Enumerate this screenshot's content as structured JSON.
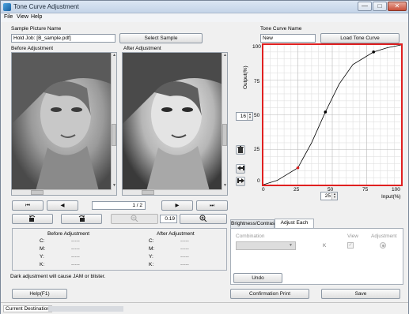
{
  "window": {
    "title": "Tone Curve Adjustment",
    "minimize": "—",
    "maximize": "□",
    "close": "✕"
  },
  "menu": [
    "File",
    "View",
    "Help"
  ],
  "sample": {
    "label": "Sample Picture Name",
    "value": "Hold Job: [B_sample.pdf]",
    "button": "Select Sample"
  },
  "before_label": "Before Adjustment",
  "after_label": "After Adjustment",
  "nav": {
    "first": "⏮",
    "prev": "◀",
    "next": "▶",
    "last": "⏭",
    "page": "1",
    "page_sep": "/",
    "page_total": "2"
  },
  "tools": {
    "rotate_left_icon": "rotate-left-icon",
    "rotate_right_icon": "rotate-right-icon",
    "zoom_out_icon": "zoom-out-icon",
    "zoom_value": "0.19",
    "zoom_in_icon": "zoom-in-icon"
  },
  "color_table": {
    "before_header": "Before Adjustment",
    "after_header": "After Adjustment",
    "rows": [
      {
        "label": "C:",
        "before": "-----",
        "after": "-----"
      },
      {
        "label": "M:",
        "before": "-----",
        "after": "-----"
      },
      {
        "label": "Y:",
        "before": "-----",
        "after": "-----"
      },
      {
        "label": "K:",
        "before": "-----",
        "after": "-----"
      }
    ]
  },
  "warning": "Dark adjustment will cause JAM or blister.",
  "help_button": "Help(F1)",
  "tone_curve": {
    "label": "Tone Curve Name",
    "value": "New",
    "button": "Load Tone Curve"
  },
  "graph": {
    "ylabel": "Output(%)",
    "xlabel": "Input(%)",
    "yticks": [
      "100",
      "75",
      "50",
      "25",
      "0"
    ],
    "xticks": [
      "0",
      "25",
      "50",
      "75",
      "100"
    ]
  },
  "chart_data": {
    "type": "line",
    "x": [
      0,
      10,
      25,
      35,
      45,
      55,
      65,
      80,
      90,
      100
    ],
    "y": [
      0,
      3,
      12,
      30,
      52,
      72,
      86,
      95,
      98,
      100
    ],
    "control_points": [
      {
        "x": 25,
        "y": 12,
        "color": "#e02020"
      },
      {
        "x": 45,
        "y": 52,
        "color": "#000000"
      },
      {
        "x": 80,
        "y": 95,
        "color": "#000000"
      }
    ],
    "xlabel": "Input(%)",
    "ylabel": "Output(%)",
    "xlim": [
      0,
      100
    ],
    "ylim": [
      0,
      100
    ],
    "grid": true
  },
  "spin_output": "16",
  "spin_input": "25",
  "tabs": [
    "Brightness/Contrast",
    "Adjust Each Color"
  ],
  "adjust": {
    "combination_label": "Combination",
    "view_label": "View",
    "adjustment_label": "Adjustment",
    "channel": "K",
    "undo": "Undo"
  },
  "confirm_button": "Confirmation Print",
  "save_button": "Save",
  "status": {
    "label": "Current Destination"
  },
  "colors": {
    "accent_red": "#e02020",
    "title_bar": "#c4d4e8"
  }
}
